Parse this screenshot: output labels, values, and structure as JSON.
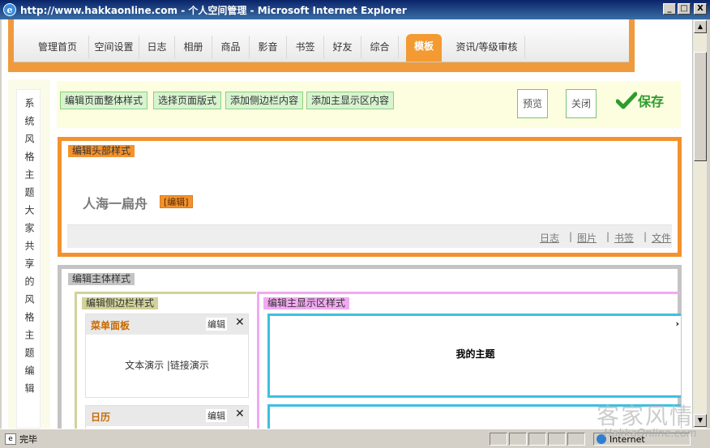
{
  "window": {
    "title": "http://www.hakkaonline.com - 个人空间管理 - Microsoft Internet Explorer",
    "icon": "ie-icon",
    "buttons": [
      "_",
      "□",
      "X"
    ]
  },
  "nav": {
    "tabs": [
      "管理首页",
      "空间设置",
      "日志",
      "相册",
      "商品",
      "影音",
      "书签",
      "好友",
      "综合",
      "模板",
      "资讯/等级审核"
    ],
    "active": "模板"
  },
  "leftcol": {
    "text": "系统风格主题大家共享的风格主题编辑"
  },
  "toolbar": {
    "buttons": [
      "编辑页面整体样式",
      "选择页面版式",
      "添加侧边栏内容",
      "添加主显示区内容"
    ],
    "preview": "预览",
    "close": "关闭",
    "save": "保存"
  },
  "header_section": {
    "tag": "编辑头部样式",
    "site_title": "人海一扁舟",
    "edit": "[编辑]",
    "links": [
      "日志",
      "图片",
      "书签",
      "文件"
    ],
    "separator": "|"
  },
  "body_section": {
    "tag": "编辑主体样式",
    "sidebar_tag": "编辑侧边栏样式",
    "main_tag": "编辑主显示区样式",
    "panels": [
      {
        "title": "菜单面板",
        "edit": "编辑",
        "close": "✕",
        "content": "文本演示 |链接演示"
      },
      {
        "title": "日历",
        "edit": "编辑",
        "close": "✕"
      }
    ],
    "main_box": {
      "title": "我的主题",
      "chevron": "›"
    }
  },
  "statusbar": {
    "text": "完毕",
    "zone": "Internet"
  },
  "watermark": {
    "chinese": "客家风情",
    "url": "HakkaOnline.com"
  },
  "colors": {
    "accent_orange": "#f3922d",
    "toolbar_green": "#d7f3d0",
    "save_green": "#2c9c2c",
    "main_pink": "#f2a9f2",
    "main_blue": "#3dc0e0"
  }
}
